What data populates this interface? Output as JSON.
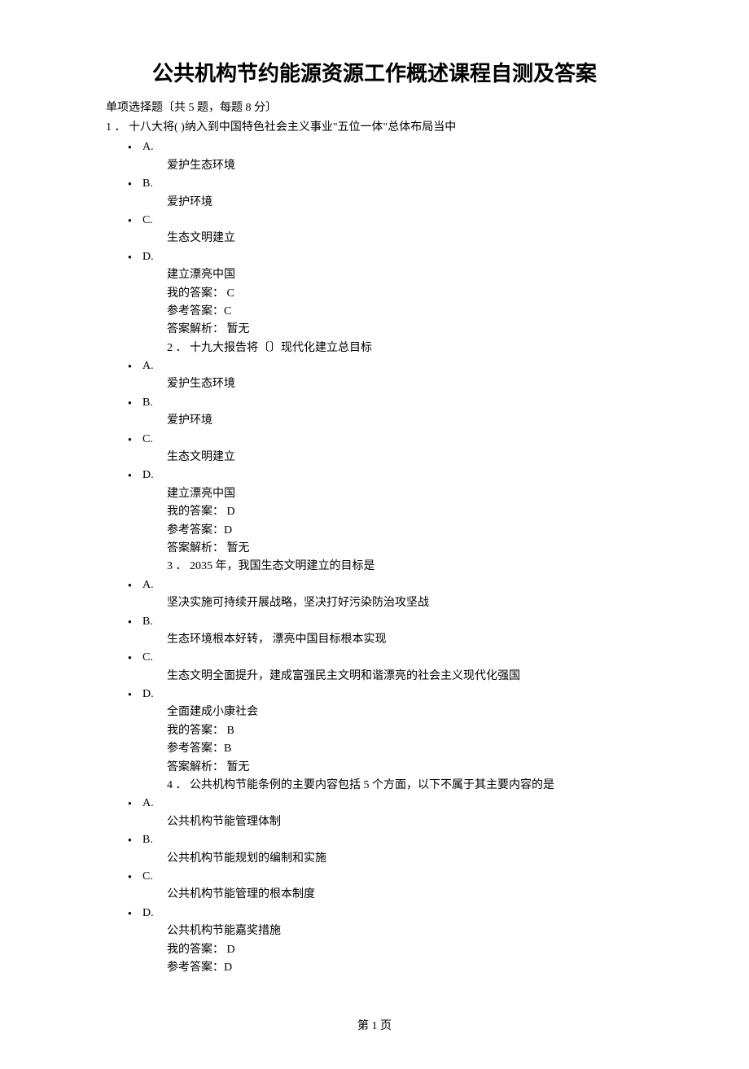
{
  "title": "公共机构节约能源资源工作概述课程自测及答案",
  "section_header": "单项选择题〔共 5 题，每题 8 分〕",
  "q1": {
    "prompt": "1 ． 十八大将( )纳入到中国特色社会主义事业\"五位一体\"总体布局当中",
    "optA_letter": "A.",
    "optA_text": "爱护生态环境",
    "optB_letter": "B.",
    "optB_text": "爱护环境",
    "optC_letter": "C.",
    "optC_text": "生态文明建立",
    "optD_letter": "D.",
    "optD_text": "建立漂亮中国",
    "my_answer": "我的答案： C",
    "ref_answer": "参考答案：C",
    "analysis": "答案解析： 暂无"
  },
  "q2": {
    "prompt": "2 ． 十九大报告将〔〕现代化建立总目标",
    "optA_letter": "A.",
    "optA_text": "爱护生态环境",
    "optB_letter": "B.",
    "optB_text": "爱护环境",
    "optC_letter": "C.",
    "optC_text": "生态文明建立",
    "optD_letter": "D.",
    "optD_text": "建立漂亮中国",
    "my_answer": "我的答案： D",
    "ref_answer": "参考答案：D",
    "analysis": "答案解析： 暂无"
  },
  "q3": {
    "prompt": "3 ． 2035 年，我国生态文明建立的目标是",
    "optA_letter": "A.",
    "optA_text": "坚决实施可持续开展战略，坚决打好污染防治攻坚战",
    "optB_letter": "B.",
    "optB_text": "生态环境根本好转， 漂亮中国目标根本实现",
    "optC_letter": "C.",
    "optC_text": "生态文明全面提升，建成富强民主文明和谐漂亮的社会主义现代化强国",
    "optD_letter": "D.",
    "optD_text": "全面建成小康社会",
    "my_answer": "我的答案： B",
    "ref_answer": "参考答案：B",
    "analysis": "答案解析： 暂无"
  },
  "q4": {
    "prompt": "4 ． 公共机构节能条例的主要内容包括 5 个方面，以下不属于其主要内容的是",
    "optA_letter": "A.",
    "optA_text": "公共机构节能管理体制",
    "optB_letter": "B.",
    "optB_text": "公共机构节能规划的编制和实施",
    "optC_letter": "C.",
    "optC_text": "公共机构节能管理的根本制度",
    "optD_letter": "D.",
    "optD_text": "公共机构节能嘉奖措施",
    "my_answer": "我的答案： D",
    "ref_answer": "参考答案：D"
  },
  "footer": "第 1 页"
}
